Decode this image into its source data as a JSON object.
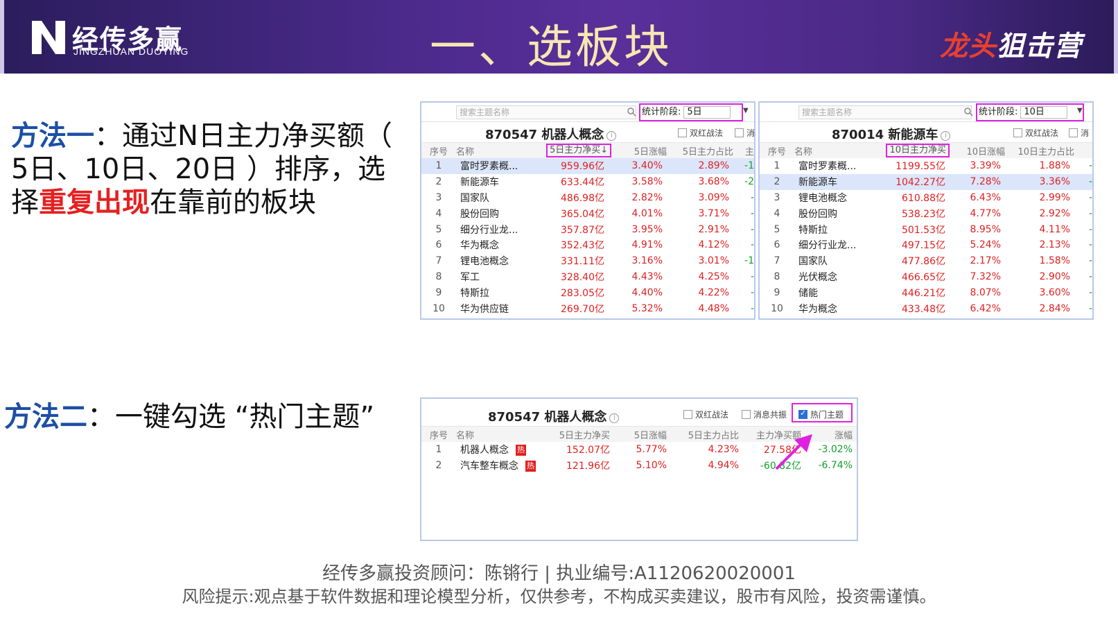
{
  "header": {
    "logo_cn": "经传多赢",
    "logo_en": "JINGZHUAN DUOYING",
    "title": "一、选板块",
    "brand_a": "龙头",
    "brand_b": "狙击营"
  },
  "method1": {
    "title": "方法一",
    "text1": "：通过N日主力净买额（ 5日、10日、20日 ）排序，选择",
    "highlight": "重复出现",
    "text2": "在靠前的板块"
  },
  "method2": {
    "title": "方法二",
    "text": "：一键勾选 “热门主题”"
  },
  "panel1": {
    "search_placeholder": "搜索主题名称",
    "stage_label": "统计阶段:",
    "stage_value": "5日",
    "title": "870547 机器人概念",
    "chk_label": "双红战法",
    "chk2_label": "消",
    "headers": [
      "序号",
      "名称",
      "5日主力净买↓",
      "5日涨幅",
      "5日主力占比",
      "主"
    ],
    "rows": [
      {
        "idx": "1",
        "name": "富时罗素概...",
        "net": "959.96亿",
        "pct": "3.40%",
        "ratio": "2.89%",
        "extra": "-1"
      },
      {
        "idx": "2",
        "name": "新能源车",
        "net": "633.44亿",
        "pct": "3.58%",
        "ratio": "3.68%",
        "extra": "-2"
      },
      {
        "idx": "3",
        "name": "国家队",
        "net": "486.98亿",
        "pct": "2.82%",
        "ratio": "3.09%",
        "extra": "-"
      },
      {
        "idx": "4",
        "name": "股份回购",
        "net": "365.04亿",
        "pct": "4.01%",
        "ratio": "3.71%",
        "extra": "-"
      },
      {
        "idx": "5",
        "name": "细分行业龙...",
        "net": "357.87亿",
        "pct": "3.95%",
        "ratio": "2.91%",
        "extra": "-"
      },
      {
        "idx": "6",
        "name": "华为概念",
        "net": "352.43亿",
        "pct": "4.91%",
        "ratio": "4.12%",
        "extra": "-"
      },
      {
        "idx": "7",
        "name": "锂电池概念",
        "net": "331.11亿",
        "pct": "3.16%",
        "ratio": "3.01%",
        "extra": "-1"
      },
      {
        "idx": "8",
        "name": "军工",
        "net": "328.40亿",
        "pct": "4.43%",
        "ratio": "4.25%",
        "extra": "-"
      },
      {
        "idx": "9",
        "name": "特斯拉",
        "net": "283.05亿",
        "pct": "4.40%",
        "ratio": "4.22%",
        "extra": "-"
      },
      {
        "idx": "10",
        "name": "华为供应链",
        "net": "269.70亿",
        "pct": "5.32%",
        "ratio": "4.48%",
        "extra": "-"
      }
    ]
  },
  "panel2": {
    "search_placeholder": "搜索主题名称",
    "stage_label": "统计阶段:",
    "stage_value": "10日",
    "title": "870014 新能源车",
    "chk_label": "双红战法",
    "chk2_label": "消",
    "headers": [
      "序号",
      "名称",
      "10日主力净买",
      "10日涨幅",
      "10日主力占比",
      ""
    ],
    "rows": [
      {
        "idx": "1",
        "name": "富时罗素概...",
        "net": "1199.55亿",
        "pct": "3.39%",
        "ratio": "1.88%",
        "extra": "-"
      },
      {
        "idx": "2",
        "name": "新能源车",
        "net": "1042.27亿",
        "pct": "7.28%",
        "ratio": "3.36%",
        "extra": "-"
      },
      {
        "idx": "3",
        "name": "锂电池概念",
        "net": "610.88亿",
        "pct": "6.43%",
        "ratio": "2.99%",
        "extra": "-"
      },
      {
        "idx": "4",
        "name": "股份回购",
        "net": "538.23亿",
        "pct": "4.77%",
        "ratio": "2.92%",
        "extra": "-"
      },
      {
        "idx": "5",
        "name": "特斯拉",
        "net": "501.53亿",
        "pct": "8.95%",
        "ratio": "4.11%",
        "extra": "-"
      },
      {
        "idx": "6",
        "name": "细分行业龙...",
        "net": "497.15亿",
        "pct": "5.24%",
        "ratio": "2.13%",
        "extra": "-"
      },
      {
        "idx": "7",
        "name": "国家队",
        "net": "477.86亿",
        "pct": "2.17%",
        "ratio": "1.58%",
        "extra": "-"
      },
      {
        "idx": "8",
        "name": "光伏概念",
        "net": "466.65亿",
        "pct": "7.32%",
        "ratio": "2.90%",
        "extra": "-"
      },
      {
        "idx": "9",
        "name": "储能",
        "net": "446.21亿",
        "pct": "8.07%",
        "ratio": "3.60%",
        "extra": "-"
      },
      {
        "idx": "10",
        "name": "华为概念",
        "net": "433.48亿",
        "pct": "6.42%",
        "ratio": "2.84%",
        "extra": "-"
      }
    ]
  },
  "panel3": {
    "title": "870547 机器人概念",
    "chk1": "双红战法",
    "chk2": "消息共振",
    "chk3": "热门主题",
    "headers": [
      "序号",
      "名称",
      "5日主力净买",
      "5日涨幅",
      "5日主力占比",
      "主力净买额",
      "涨幅"
    ],
    "hot_tag": "热",
    "rows": [
      {
        "idx": "1",
        "name": "机器人概念",
        "net": "152.07亿",
        "pct": "5.77%",
        "ratio": "4.23%",
        "mainnet": "27.58亿",
        "chg": "-3.02%"
      },
      {
        "idx": "2",
        "name": "汽车整车概念",
        "net": "121.96亿",
        "pct": "5.10%",
        "ratio": "4.94%",
        "mainnet": "-60.82亿",
        "chg": "-6.74%"
      }
    ]
  },
  "footer": {
    "line1": "经传多赢投资顾问：陈锵行 | 执业编号:A1120620020001",
    "line2": "风险提示:观点基于软件数据和理论模型分析，仅供参考，不构成买卖建议，股市有风险，投资需谨慎。"
  },
  "colors": {
    "accent_blue": "#1d4fa6",
    "highlight_red": "#e52020",
    "frame_magenta": "#e020e0"
  }
}
